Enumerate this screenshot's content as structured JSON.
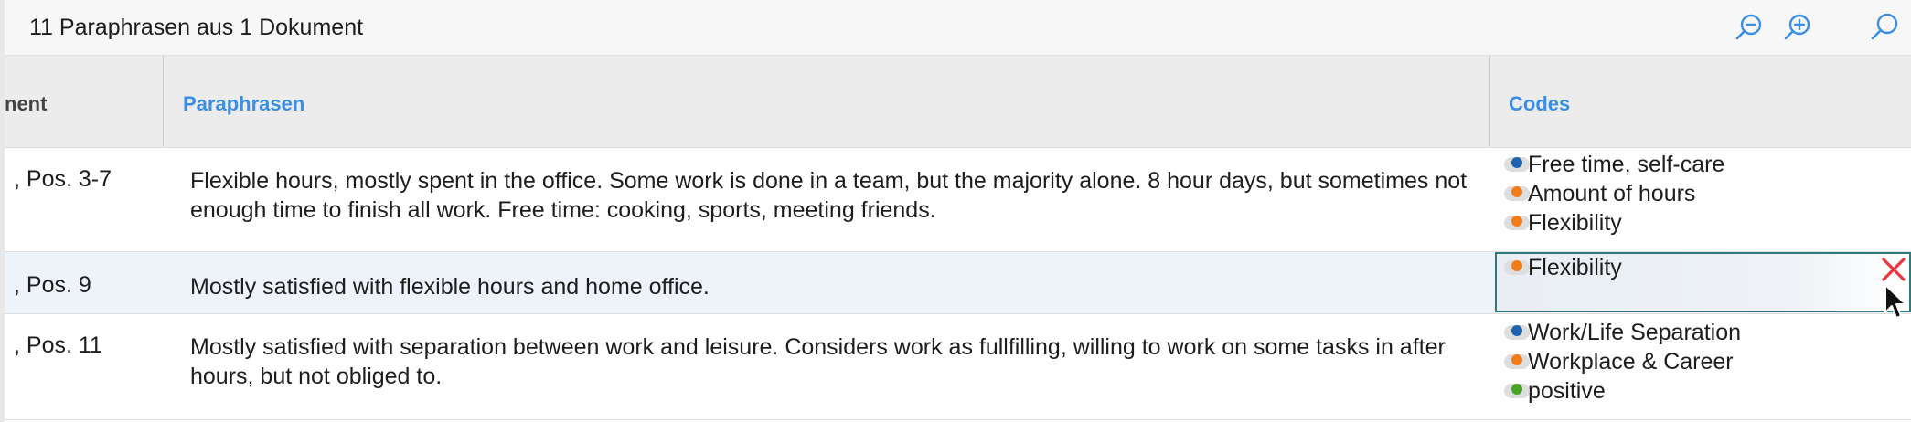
{
  "toolbar": {
    "title": "11 Paraphrasen aus 1 Dokument",
    "icons": [
      "zoom-out-icon",
      "zoom-in-icon",
      "search-icon"
    ],
    "accent_color": "#3a8ee6"
  },
  "table": {
    "columns": [
      "nent",
      "Paraphrasen",
      "Codes"
    ],
    "rows": [
      {
        "position": ", Pos. 3-7",
        "paraphrase": "Flexible hours, mostly spent in the office. Some work is done in a team, but the majority alone. 8 hour days, but sometimes not enough time to finish all work. Free time: cooking, sports, meeting friends.",
        "codes": [
          {
            "label": "Free time, self-care",
            "color": "#1f63b0"
          },
          {
            "label": "Amount of hours",
            "color": "#f07d1a"
          },
          {
            "label": "Flexibility",
            "color": "#f07d1a"
          }
        ]
      },
      {
        "position": ", Pos. 9",
        "paraphrase": "Mostly satisfied with flexible hours and home office.",
        "codes": [
          {
            "label": "Flexibility",
            "color": "#f07d1a"
          }
        ]
      },
      {
        "position": ", Pos. 11",
        "paraphrase": "Mostly satisfied with separation between work and leisure. Considers work as fullfilling, willing to work on some tasks in after hours, but not obliged to.",
        "codes": [
          {
            "label": "Work/Life Separation",
            "color": "#1f63b0"
          },
          {
            "label": "Workplace & Career",
            "color": "#f07d1a"
          },
          {
            "label": "positive",
            "color": "#4aa329"
          }
        ]
      }
    ]
  }
}
